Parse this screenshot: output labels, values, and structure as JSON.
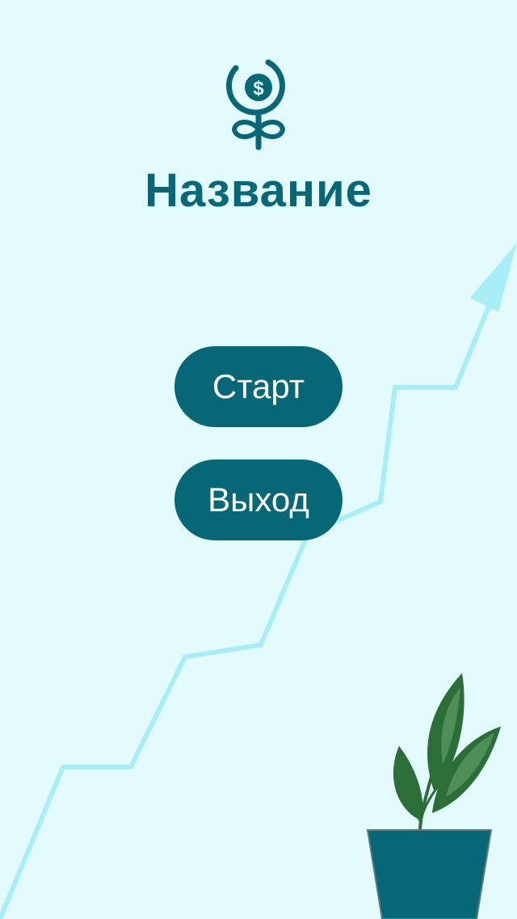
{
  "app": {
    "title": "Название"
  },
  "menu": {
    "start_label": "Старт",
    "exit_label": "Выход"
  },
  "icons": {
    "logo": "money-flower-icon",
    "background_graph": "growth-arrow-icon",
    "decoration": "potted-plant-icon"
  },
  "colors": {
    "background": "#e3fbfd",
    "primary": "#066877",
    "graph_line": "#a8eef9",
    "leaf_dark": "#2b6e37",
    "leaf_light": "#4f8f57",
    "pot_outline": "#5f7b80"
  }
}
